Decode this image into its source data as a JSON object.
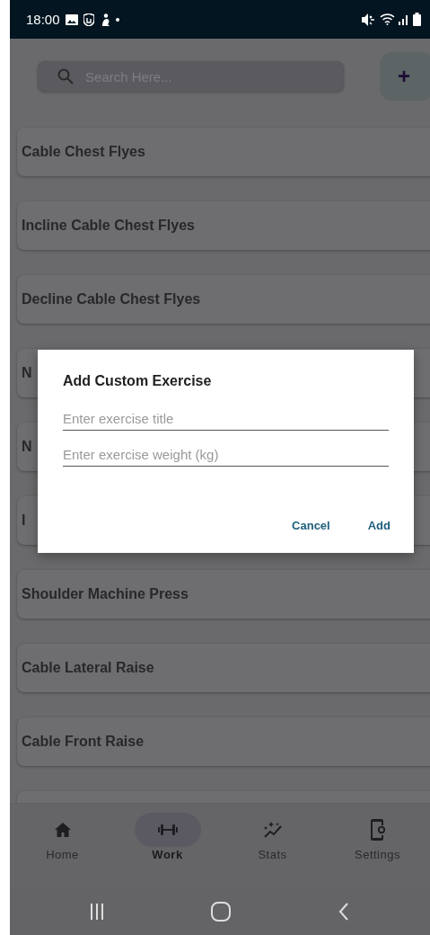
{
  "status_bar": {
    "time": "18:00"
  },
  "search": {
    "placeholder": "Search Here..."
  },
  "add_button": {
    "label": "+"
  },
  "exercises": [
    {
      "name": "Cable Chest Flyes"
    },
    {
      "name": "Incline Cable Chest Flyes"
    },
    {
      "name": "Decline Cable Chest Flyes"
    },
    {
      "name": "N"
    },
    {
      "name": "N"
    },
    {
      "name": "I"
    },
    {
      "name": "Shoulder Machine Press"
    },
    {
      "name": "Cable Lateral Raise"
    },
    {
      "name": "Cable Front Raise"
    }
  ],
  "dialog": {
    "title": "Add Custom Exercise",
    "fields": [
      {
        "placeholder": "Enter exercise title"
      },
      {
        "placeholder": "Enter exercise weight (kg)"
      }
    ],
    "actions": [
      "Cancel",
      "Add"
    ]
  },
  "bottom_nav": [
    {
      "label": "Home",
      "kind": "home",
      "selected": false
    },
    {
      "label": "Work",
      "kind": "dumbbell",
      "selected": true
    },
    {
      "label": "Stats",
      "kind": "stats",
      "selected": false
    },
    {
      "label": "Settings",
      "kind": "settings",
      "selected": false
    }
  ]
}
